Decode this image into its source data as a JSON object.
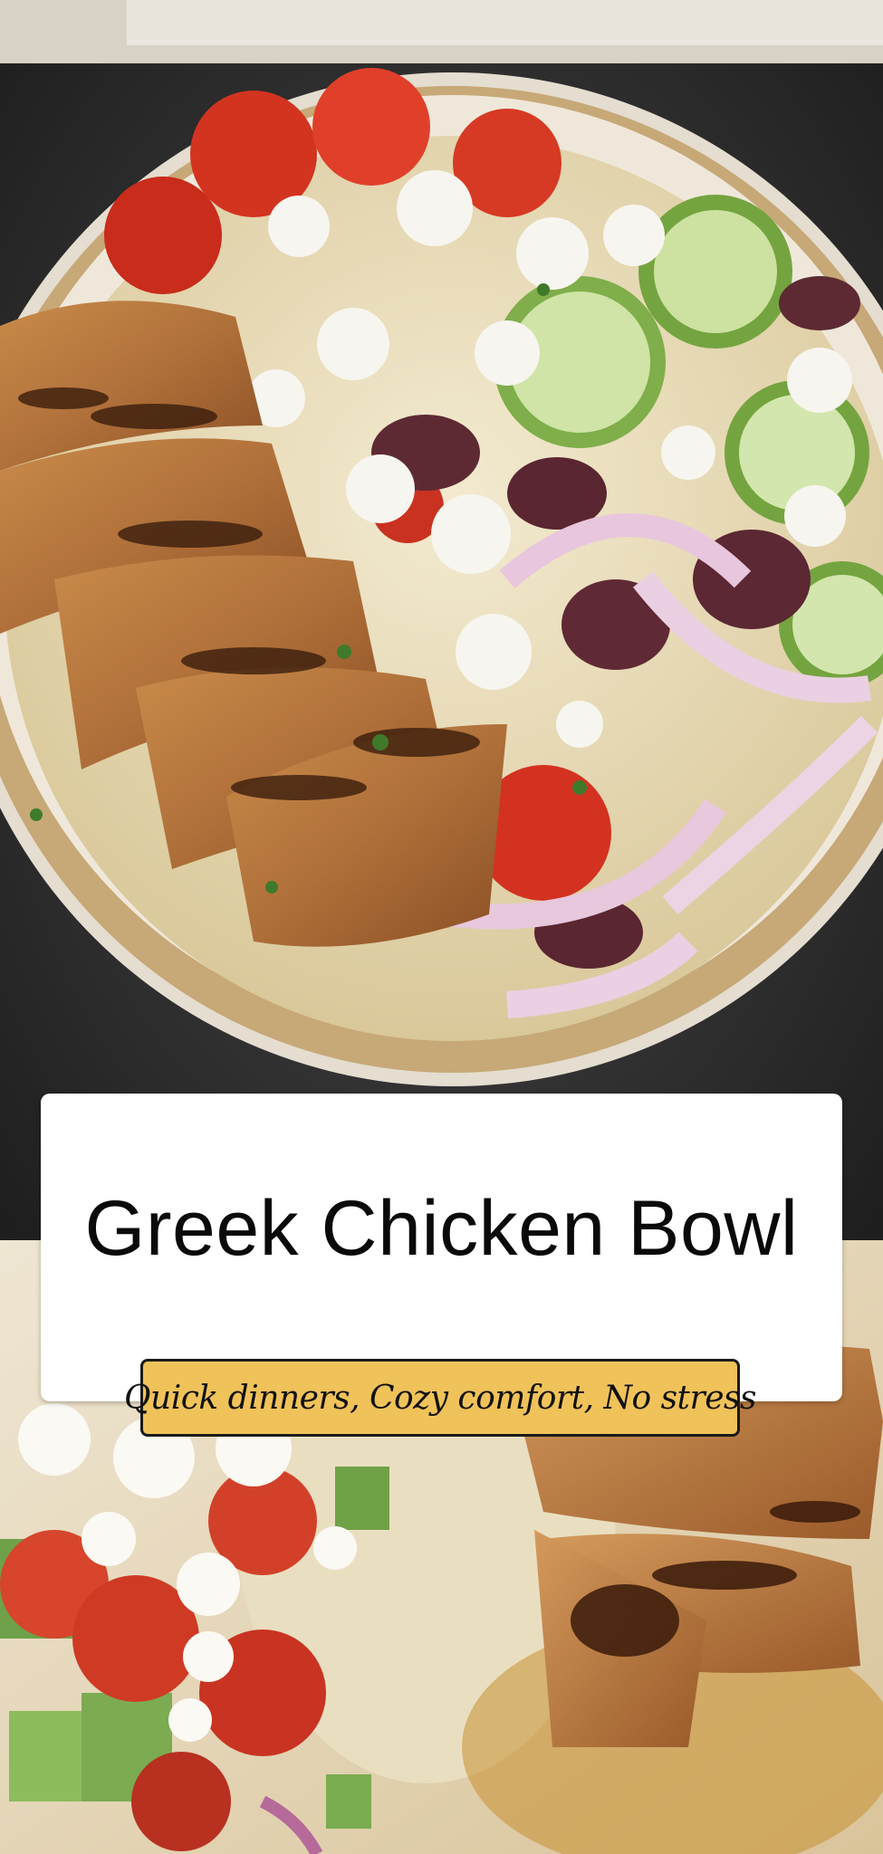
{
  "title": "Greek Chicken Bowl",
  "tagline": "Quick dinners, Cozy comfort, No stress",
  "colors": {
    "tagline_background": "#f0c25a",
    "card_background": "#ffffff",
    "title_text": "#0a0a0a"
  }
}
